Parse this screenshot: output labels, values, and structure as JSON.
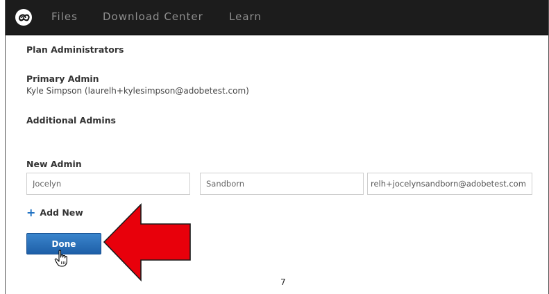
{
  "nav": {
    "items": [
      "Files",
      "Download Center",
      "Learn"
    ]
  },
  "admins": {
    "section_title": "Plan Administrators",
    "primary_label": "Primary Admin",
    "primary_value": "Kyle Simpson (laurelh+kylesimpson@adobetest.com)",
    "additional_label": "Additional Admins",
    "new_admin_label": "New Admin",
    "first_name_value": "Jocelyn",
    "last_name_value": "Sandborn",
    "email_value": "relh+jocelynsandborn@adobetest.com"
  },
  "actions": {
    "add_new_label": "Add New",
    "done_label": "Done"
  },
  "annotation": {
    "arrow_color": "#e8000b",
    "page_number": "7"
  },
  "icons": [
    "creative-cloud-logo-icon",
    "plus-icon",
    "hand-cursor-icon",
    "red-arrow-icon"
  ],
  "colors": {
    "topbar": "#1c1c1c",
    "button": "#2a73bd",
    "accent": "#1b6fc2"
  }
}
